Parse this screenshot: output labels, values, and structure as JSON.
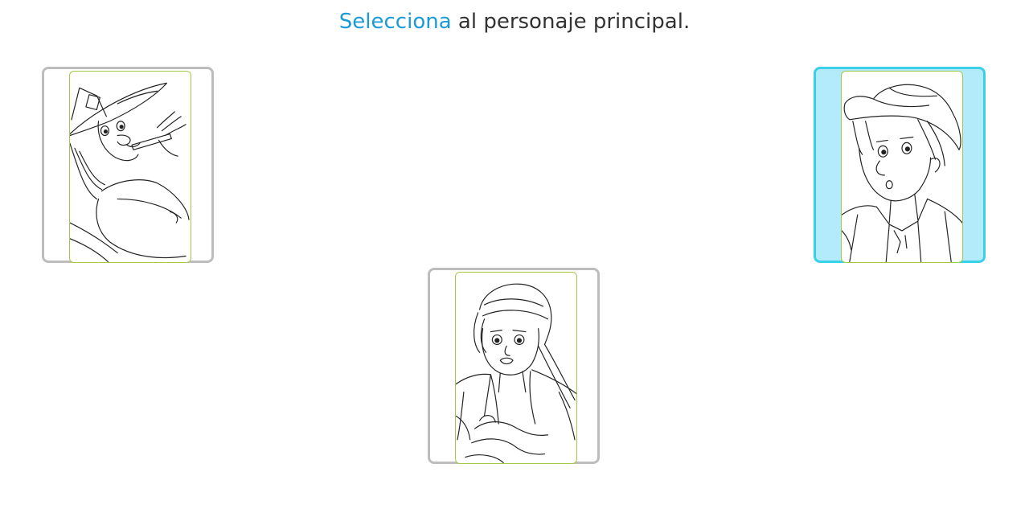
{
  "instruction": {
    "verb": "Selecciona",
    "rest": " al personaje principal."
  },
  "cards": [
    {
      "character": "witch-character-drawing",
      "selected": false
    },
    {
      "character": "boy-with-hat-character-drawing",
      "selected": true
    },
    {
      "character": "girl-with-headscarf-character-drawing",
      "selected": false
    }
  ],
  "colors": {
    "accent": "#1a9ad6",
    "selected_border": "#3ad0ea",
    "selected_fill": "#b3ebfa",
    "card_border": "#bdbdbd",
    "image_frame": "#a4c94a"
  }
}
